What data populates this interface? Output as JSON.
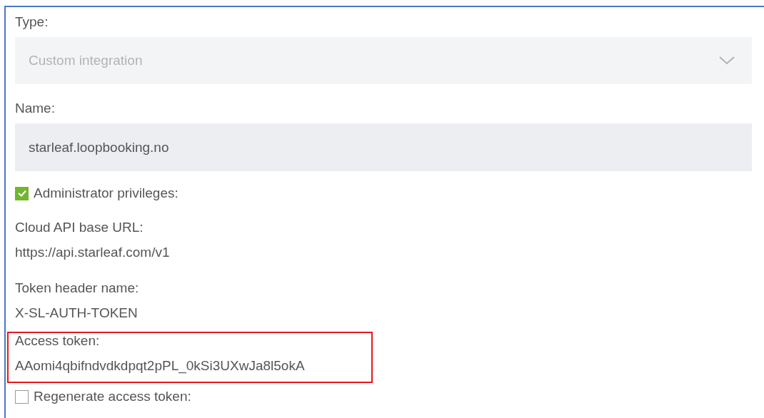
{
  "type_field": {
    "label": "Type:",
    "value": "Custom integration",
    "disabled": true
  },
  "name_field": {
    "label": "Name:",
    "value": "starleaf.loopbooking.no"
  },
  "items": [
    {
      "kind": "checkbox",
      "label": "Administrator privileges:",
      "checked": true
    },
    {
      "kind": "info",
      "label": "Cloud API base URL:",
      "value": "https://api.starleaf.com/v1",
      "highlighted": false
    },
    {
      "kind": "info",
      "label": "Token header name:",
      "value": "X-SL-AUTH-TOKEN",
      "highlighted": false
    },
    {
      "kind": "info",
      "label": "Access token:",
      "value": "AAomi4qbifndvdkdpqt2pPL_0kSi3UXwJa8l5okA",
      "highlighted": true
    },
    {
      "kind": "checkbox",
      "label": "Regenerate access token:",
      "checked": false
    }
  ]
}
